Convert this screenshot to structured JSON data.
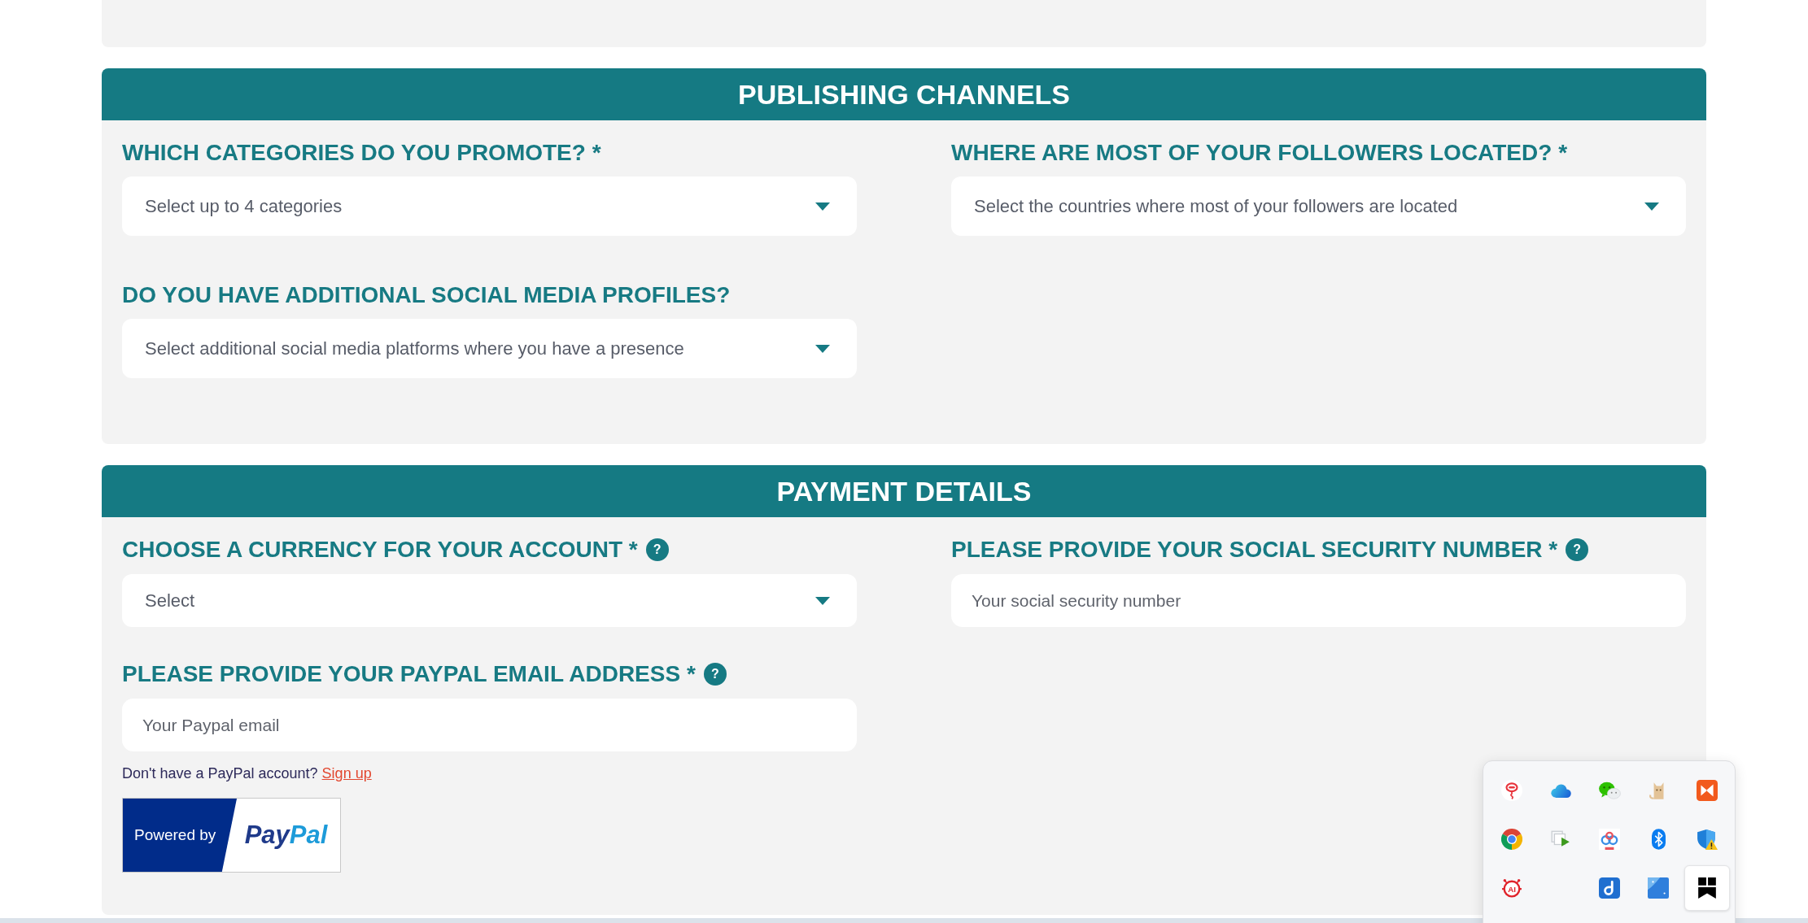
{
  "sections": [
    {
      "title": "PUBLISHING CHANNELS",
      "fields": [
        {
          "kind": "select",
          "label": "WHICH CATEGORIES DO YOU PROMOTE? *",
          "placeholder": "Select up to 4 categories"
        },
        {
          "kind": "select",
          "label": "WHERE ARE MOST OF YOUR FOLLOWERS LOCATED? *",
          "placeholder": "Select the countries where most of your followers are located"
        },
        {
          "kind": "select",
          "label": "DO YOU HAVE ADDITIONAL SOCIAL MEDIA PROFILES?",
          "placeholder": "Select additional social media platforms where you have a presence"
        }
      ]
    },
    {
      "title": "PAYMENT DETAILS",
      "fields": [
        {
          "kind": "select",
          "label": "CHOOSE A CURRENCY FOR YOUR ACCOUNT *",
          "help": "?",
          "placeholder": "Select"
        },
        {
          "kind": "text",
          "label": "PLEASE PROVIDE YOUR SOCIAL SECURITY NUMBER *",
          "help": "?",
          "placeholder": "Your social security number"
        },
        {
          "kind": "text",
          "label": "PLEASE PROVIDE YOUR PAYPAL EMAIL ADDRESS *",
          "help": "?",
          "placeholder": "Your Paypal email"
        }
      ],
      "signup_note": {
        "text": "Don't have a PayPal account?",
        "link": "Sign up"
      },
      "paypal_badge": {
        "caption": "Powered by",
        "wordmark": [
          {
            "text": "Pay",
            "color": "#1f3a8a"
          },
          {
            "text": "Pal",
            "color": "#1d9bd9"
          }
        ]
      }
    }
  ],
  "tray": {
    "icons": [
      {
        "hovered": false
      },
      {
        "hovered": false
      },
      {
        "hovered": false
      },
      {
        "hovered": false
      },
      {
        "hovered": false
      },
      {
        "hovered": false
      },
      {
        "hovered": false
      },
      {
        "hovered": false
      },
      {
        "hovered": false
      },
      {
        "hovered": false
      },
      {
        "hovered": false,
        "text": "AI"
      },
      {
        "hovered": false
      },
      {
        "hovered": false
      },
      {
        "hovered": false
      },
      {
        "hovered": true
      }
    ]
  }
}
